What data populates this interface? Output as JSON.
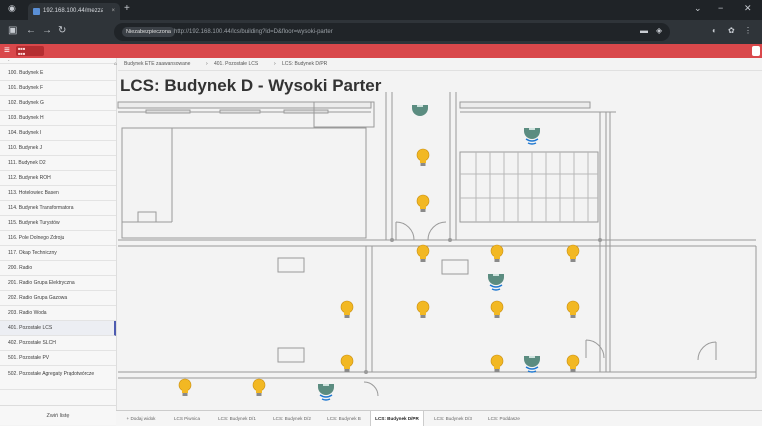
{
  "browser": {
    "tab_title": "192.168.100.44/mezzanine",
    "tab_close": "×",
    "new_tab": "+",
    "win_min": "⌄",
    "win_restore": "−",
    "win_close": "✕",
    "chip": "Niezabezpieczona",
    "url": "http://192.168.100.44/lcs/building?id=D&floor=wysoki-parter"
  },
  "sidebar": {
    "items": [
      "100. Budynek E",
      "101. Budynek F",
      "102. Budynek G",
      "103. Budynek H",
      "104. Budynek I",
      "110. Budynek J",
      "111. Budynek D2",
      "112. Budynek ROH",
      "113. Hotelowiec Basen",
      "114. Budynek Transformatora",
      "115. Budynek Turystów",
      "116. Pole Dolnego Zdroju",
      "117. Okap Techniczny",
      "200. Radio",
      "201. Radio Grupa Elektryczna",
      "202. Radio Grupa Gazowa",
      "203. Radio Woda",
      "401. Pozostałe LCS",
      "402. Pozostałe SLCH",
      "501. Pozostałe PV",
      "502. Pozostałe Agregaty Prądotwórcze"
    ],
    "active_index": 17,
    "footer": "Zwiń listę"
  },
  "breadcrumb": {
    "home": "⌂",
    "c1": "Budynek ETE zaawansowane",
    "sep1": "›",
    "c2": "401. Pozostałe LCS",
    "sep2": "›",
    "c3": "LCS: Budynek D/PR"
  },
  "page": {
    "title": "LCS: Budynek D - Wysoki Parter"
  },
  "plan_tabs": {
    "items": [
      "+ Dodaj widok",
      "LCS Piwnica",
      "LCS: Budynek D/1",
      "LCS: Budynek D/2",
      "LCS: Budynek B",
      "LCS: Budynek D/PR",
      "LCS: Budynek D/3",
      "LCS: Poddasze"
    ],
    "active_index": 5
  },
  "colors": {
    "accent": "#d9484b",
    "bulb": "#f2b823",
    "sensor": "#5b8c80",
    "wave": "#1f78d1"
  }
}
